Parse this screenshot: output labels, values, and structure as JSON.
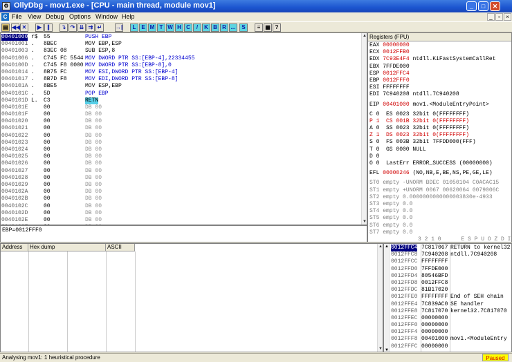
{
  "title": "OllyDbg - mov1.exe - [CPU - main thread, module mov1]",
  "window_buttons": {
    "min": "_",
    "max": "□",
    "close": "✕"
  },
  "menu": [
    "File",
    "View",
    "Debug",
    "Options",
    "Window",
    "Help"
  ],
  "menu_icon": "C",
  "toolbar_letters": [
    "L",
    "E",
    "M",
    "T",
    "W",
    "H",
    "C",
    "/",
    "K",
    "B",
    "R",
    "...",
    "S"
  ],
  "disasm": [
    {
      "addr": "00401000",
      "hex": "55",
      "asm": "PUSH EBP",
      "mark": "r$",
      "sel": true
    },
    {
      "addr": "00401001",
      "hex": "8BEC",
      "asm": "MOV EBP,ESP",
      "mark": "."
    },
    {
      "addr": "00401003",
      "hex": "83EC 08",
      "asm": "SUB ESP,8",
      "mark": "."
    },
    {
      "addr": "00401006",
      "hex": "C745 FC 5544…",
      "asm": "MOV DWORD PTR SS:[EBP-4],22334455",
      "mark": "."
    },
    {
      "addr": "0040100D",
      "hex": "C745 F8 0000…",
      "asm": "MOV DWORD PTR SS:[EBP-8],0",
      "mark": "."
    },
    {
      "addr": "00401014",
      "hex": "8B75 FC",
      "asm": "MOV ESI,DWORD PTR SS:[EBP-4]",
      "mark": "."
    },
    {
      "addr": "00401017",
      "hex": "8B7D F8",
      "asm": "MOV EDI,DWORD PTR SS:[EBP-8]",
      "mark": "."
    },
    {
      "addr": "0040101A",
      "hex": "8BE5",
      "asm": "MOV ESP,EBP",
      "mark": "."
    },
    {
      "addr": "0040101C",
      "hex": "5D",
      "asm": "POP EBP",
      "mark": "."
    },
    {
      "addr": "0040101D",
      "hex": "C3",
      "asm": "RETN",
      "mark": "L."
    },
    {
      "addr": "0040101E",
      "hex": "00",
      "asm": "DB 00"
    },
    {
      "addr": "0040101F",
      "hex": "00",
      "asm": "DB 00"
    },
    {
      "addr": "00401020",
      "hex": "00",
      "asm": "DB 00"
    },
    {
      "addr": "00401021",
      "hex": "00",
      "asm": "DB 00"
    },
    {
      "addr": "00401022",
      "hex": "00",
      "asm": "DB 00"
    },
    {
      "addr": "00401023",
      "hex": "00",
      "asm": "DB 00"
    },
    {
      "addr": "00401024",
      "hex": "00",
      "asm": "DB 00"
    },
    {
      "addr": "00401025",
      "hex": "00",
      "asm": "DB 00"
    },
    {
      "addr": "00401026",
      "hex": "00",
      "asm": "DB 00"
    },
    {
      "addr": "00401027",
      "hex": "00",
      "asm": "DB 00"
    },
    {
      "addr": "00401028",
      "hex": "00",
      "asm": "DB 00"
    },
    {
      "addr": "00401029",
      "hex": "00",
      "asm": "DB 00"
    },
    {
      "addr": "0040102A",
      "hex": "00",
      "asm": "DB 00"
    },
    {
      "addr": "0040102B",
      "hex": "00",
      "asm": "DB 00"
    },
    {
      "addr": "0040102C",
      "hex": "00",
      "asm": "DB 00"
    },
    {
      "addr": "0040102D",
      "hex": "00",
      "asm": "DB 00"
    },
    {
      "addr": "0040102E",
      "hex": "00",
      "asm": "DB 00"
    },
    {
      "addr": "0040102F",
      "hex": "00",
      "asm": "DB 00"
    }
  ],
  "info_line": "EBP=0012FFF0",
  "registers_header": "Registers (FPU)",
  "registers": [
    {
      "name": "EAX",
      "val": "00000000",
      "note": "",
      "red": true
    },
    {
      "name": "ECX",
      "val": "0012FFB0",
      "note": "",
      "red": true
    },
    {
      "name": "EDX",
      "val": "7C93E4F4",
      "note": "ntdll.KiFastSystemCallRet",
      "red": true
    },
    {
      "name": "EBX",
      "val": "7FFDE000",
      "note": "",
      "red": false
    },
    {
      "name": "ESP",
      "val": "0012FFC4",
      "note": "",
      "red": true
    },
    {
      "name": "EBP",
      "val": "0012FFF0",
      "note": "",
      "red": true
    },
    {
      "name": "ESI",
      "val": "FFFFFFFF",
      "note": "",
      "red": false
    },
    {
      "name": "EDI",
      "val": "7C940208",
      "note": "ntdll.7C940208",
      "red": false
    }
  ],
  "eip": {
    "name": "EIP",
    "val": "00401000",
    "note": "mov1.<ModuleEntryPoint>"
  },
  "flags": [
    "C 0  ES 0023 32bit 0(FFFFFFFF)",
    "P 1  CS 001B 32bit 0(FFFFFFFF)",
    "A 0  SS 0023 32bit 0(FFFFFFFF)",
    "Z 1  DS 0023 32bit 0(FFFFFFFF)",
    "S 0  FS 003B 32bit 7FFDD000(FFF)",
    "T 0  GS 0000 NULL",
    "D 0",
    "O 0  LastErr ERROR_SUCCESS (00000000)"
  ],
  "efl": {
    "name": "EFL",
    "val": "00000246",
    "note": "(NO,NB,E,BE,NS,PE,GE,LE)"
  },
  "fpu": [
    "ST0 empty -UNORM BDEC 01050104 C0ACAC15",
    "ST1 empty +UNORM 0067 00620064 0079006C",
    "ST2 empty 0.0000000000000003830e-4933",
    "ST3 empty 0.0",
    "ST4 empty 0.0",
    "ST5 empty 0.0",
    "ST6 empty 0.0",
    "ST7 empty 0.0"
  ],
  "fpu_footer": "3 2 1 0      E S P U O Z D I",
  "dump_headers": [
    "Address",
    "Hex dump",
    "ASCII"
  ],
  "stack": [
    {
      "addr": "0012FFC4",
      "val": "7C817067",
      "note": "RETURN to kernel32",
      "sel": true
    },
    {
      "addr": "0012FFC8",
      "val": "7C940208",
      "note": "ntdll.7C940208"
    },
    {
      "addr": "0012FFCC",
      "val": "FFFFFFFF",
      "note": ""
    },
    {
      "addr": "0012FFD0",
      "val": "7FFDE000",
      "note": ""
    },
    {
      "addr": "0012FFD4",
      "val": "80546BFD",
      "note": ""
    },
    {
      "addr": "0012FFD8",
      "val": "0012FFC8",
      "note": ""
    },
    {
      "addr": "0012FFDC",
      "val": "81B17020",
      "note": ""
    },
    {
      "addr": "0012FFE0",
      "val": "FFFFFFFF",
      "note": "End of SEH chain"
    },
    {
      "addr": "0012FFE4",
      "val": "7C839AC0",
      "note": "SE handler"
    },
    {
      "addr": "0012FFE8",
      "val": "7C817070",
      "note": "kernel32.7C817070"
    },
    {
      "addr": "0012FFEC",
      "val": "00000000",
      "note": ""
    },
    {
      "addr": "0012FFF0",
      "val": "00000000",
      "note": ""
    },
    {
      "addr": "0012FFF4",
      "val": "00000000",
      "note": ""
    },
    {
      "addr": "0012FFF8",
      "val": "00401000",
      "note": "mov1.<ModuleEntry"
    },
    {
      "addr": "0012FFFC",
      "val": "00000000",
      "note": ""
    }
  ],
  "status": "Analysing mov1: 1 heuristical procedure",
  "paused": "Paused"
}
